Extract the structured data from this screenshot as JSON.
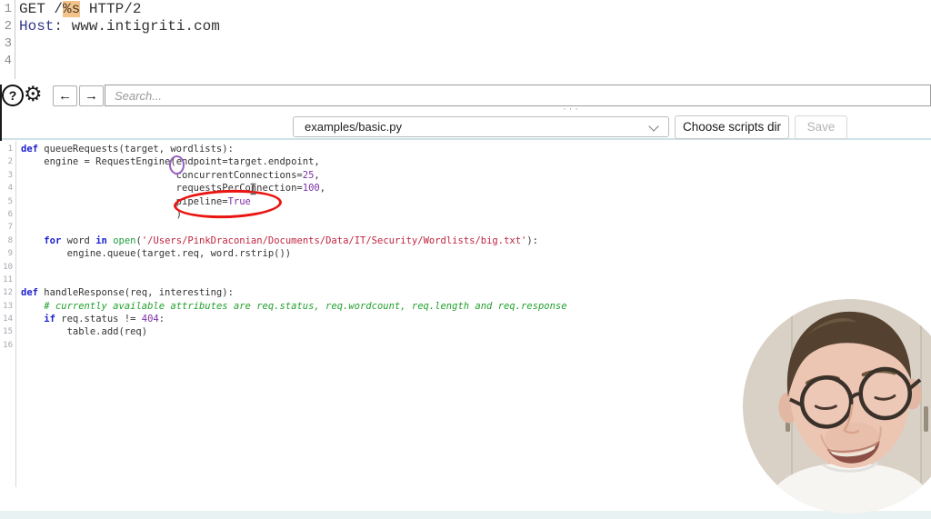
{
  "colors": {
    "syntax_keyword": "#1d1fd0",
    "syntax_number": "#7d2fa6",
    "syntax_string": "#c0243f",
    "syntax_function": "#1e9e40",
    "syntax_comment": "#22a12c",
    "payload_mark_bg": "#f3c38c",
    "annotation_red": "#ea1410",
    "bracket_highlight": "#9a5fc0",
    "separator_blue": "#cfe2e8"
  },
  "request_editor": {
    "lines": [
      {
        "n": "1",
        "segs": [
          {
            "t": "GET /",
            "c": "plain"
          },
          {
            "t": "%s",
            "c": "mark"
          },
          {
            "t": " HTTP/2",
            "c": "plain"
          }
        ]
      },
      {
        "n": "2",
        "segs": [
          {
            "t": "Host",
            "c": "hdr"
          },
          {
            "t": ": www.intigriti.com",
            "c": "plain"
          }
        ]
      },
      {
        "n": "3",
        "segs": []
      },
      {
        "n": "4",
        "segs": []
      }
    ]
  },
  "toolbar": {
    "icons": {
      "help": "?",
      "gear": "⚙",
      "back": "←",
      "forward": "→"
    },
    "search_placeholder": "Search..."
  },
  "scripts_bar": {
    "splitter_dots": "···",
    "selected_script": "examples/basic.py",
    "choose_scripts_label": "Choose scripts dir",
    "save_label": "Save"
  },
  "code_editor": {
    "lines": [
      {
        "n": "1",
        "segs": [
          {
            "t": "def",
            "c": "kw"
          },
          {
            "t": " queueRequests(target, wordlists):",
            "c": "plain"
          }
        ]
      },
      {
        "n": "2",
        "segs": [
          {
            "t": "    engine = RequestEngine",
            "c": "plain"
          },
          {
            "t": "(",
            "c": "plain"
          },
          {
            "t": "endpoint=target.endpoint,",
            "c": "plain"
          }
        ]
      },
      {
        "n": "3",
        "segs": [
          {
            "t": "                           concurrentConnections=",
            "c": "plain"
          },
          {
            "t": "25",
            "c": "num"
          },
          {
            "t": ",",
            "c": "plain"
          }
        ]
      },
      {
        "n": "4",
        "segs": [
          {
            "t": "                           requestsPerConnection=",
            "c": "plain"
          },
          {
            "t": "100",
            "c": "num"
          },
          {
            "t": ",",
            "c": "plain"
          }
        ]
      },
      {
        "n": "5",
        "segs": [
          {
            "t": "                           pipeline=",
            "c": "plain"
          },
          {
            "t": "True",
            "c": "num"
          }
        ]
      },
      {
        "n": "6",
        "segs": [
          {
            "t": "                           )",
            "c": "plain"
          }
        ]
      },
      {
        "n": "7",
        "segs": []
      },
      {
        "n": "8",
        "segs": [
          {
            "t": "    ",
            "c": "plain"
          },
          {
            "t": "for",
            "c": "kw"
          },
          {
            "t": " word ",
            "c": "plain"
          },
          {
            "t": "in",
            "c": "kw"
          },
          {
            "t": " ",
            "c": "plain"
          },
          {
            "t": "open",
            "c": "fn"
          },
          {
            "t": "(",
            "c": "plain"
          },
          {
            "t": "'/Users/PinkDraconian/Documents/Data/IT/Security/Wordlists/big.txt'",
            "c": "str"
          },
          {
            "t": "):",
            "c": "plain"
          }
        ]
      },
      {
        "n": "9",
        "segs": [
          {
            "t": "        engine.queue(target.req, word.rstrip())",
            "c": "plain"
          }
        ]
      },
      {
        "n": "10",
        "segs": []
      },
      {
        "n": "11",
        "segs": []
      },
      {
        "n": "12",
        "segs": [
          {
            "t": "def",
            "c": "kw"
          },
          {
            "t": " handleResponse(req, interesting):",
            "c": "plain"
          }
        ]
      },
      {
        "n": "13",
        "segs": [
          {
            "t": "    ",
            "c": "plain"
          },
          {
            "t": "# currently available attributes are req.status, req.wordcount, req.length and req.response",
            "c": "com"
          }
        ]
      },
      {
        "n": "14",
        "segs": [
          {
            "t": "    ",
            "c": "plain"
          },
          {
            "t": "if",
            "c": "kw"
          },
          {
            "t": " req.status != ",
            "c": "plain"
          },
          {
            "t": "404",
            "c": "num"
          },
          {
            "t": ":",
            "c": "plain"
          }
        ]
      },
      {
        "n": "15",
        "segs": [
          {
            "t": "        table.add(req)",
            "c": "plain"
          }
        ]
      },
      {
        "n": "16",
        "segs": []
      }
    ]
  }
}
